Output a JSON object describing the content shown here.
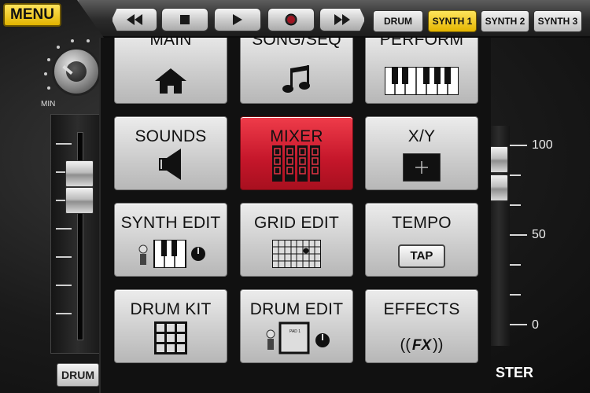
{
  "app": {
    "menu_label": "MENU",
    "knob_min_label": "MIN",
    "left_channel_button": "DRUM",
    "master_label": "STER",
    "scale": [
      "100",
      "50",
      "0"
    ]
  },
  "transport": {
    "buttons": [
      {
        "name": "rewind-button",
        "icon": "rewind-icon"
      },
      {
        "name": "stop-button",
        "icon": "stop-icon"
      },
      {
        "name": "play-button",
        "icon": "play-icon"
      },
      {
        "name": "record-button",
        "icon": "record-icon"
      },
      {
        "name": "fast-forward-button",
        "icon": "fast-forward-icon"
      }
    ],
    "tabs": [
      {
        "label": "DRUM",
        "active": false
      },
      {
        "label": "SYNTH 1",
        "active": true
      },
      {
        "label": "SYNTH 2",
        "active": false
      },
      {
        "label": "SYNTH 3",
        "active": false
      }
    ]
  },
  "menu": {
    "items": [
      {
        "label": "MAIN",
        "icon": "home-icon",
        "active": false
      },
      {
        "label": "SONG/SEQ",
        "icon": "music-note-icon",
        "active": false
      },
      {
        "label": "PERFORM",
        "icon": "piano-keys-icon",
        "active": false
      },
      {
        "label": "SOUNDS",
        "icon": "speaker-icon",
        "active": false
      },
      {
        "label": "MIXER",
        "icon": "mixer-faders-icon",
        "active": true
      },
      {
        "label": "X/Y",
        "icon": "xy-pad-icon",
        "active": false
      },
      {
        "label": "SYNTH EDIT",
        "icon": "synth-edit-icon",
        "active": false
      },
      {
        "label": "GRID EDIT",
        "icon": "grid-edit-icon",
        "active": false
      },
      {
        "label": "TEMPO",
        "icon": "tap-button-icon",
        "active": false,
        "tap_label": "TAP"
      },
      {
        "label": "DRUM KIT",
        "icon": "drum-pads-icon",
        "active": false
      },
      {
        "label": "DRUM EDIT",
        "icon": "drum-edit-icon",
        "active": false,
        "pad_label": "PAD 1"
      },
      {
        "label": "EFFECTS",
        "icon": "fx-icon",
        "active": false,
        "fx_label": "FX"
      }
    ]
  },
  "colors": {
    "accent_yellow": "#f2c800",
    "active_red": "#d42033",
    "button_gray": "#d0d0d0"
  }
}
